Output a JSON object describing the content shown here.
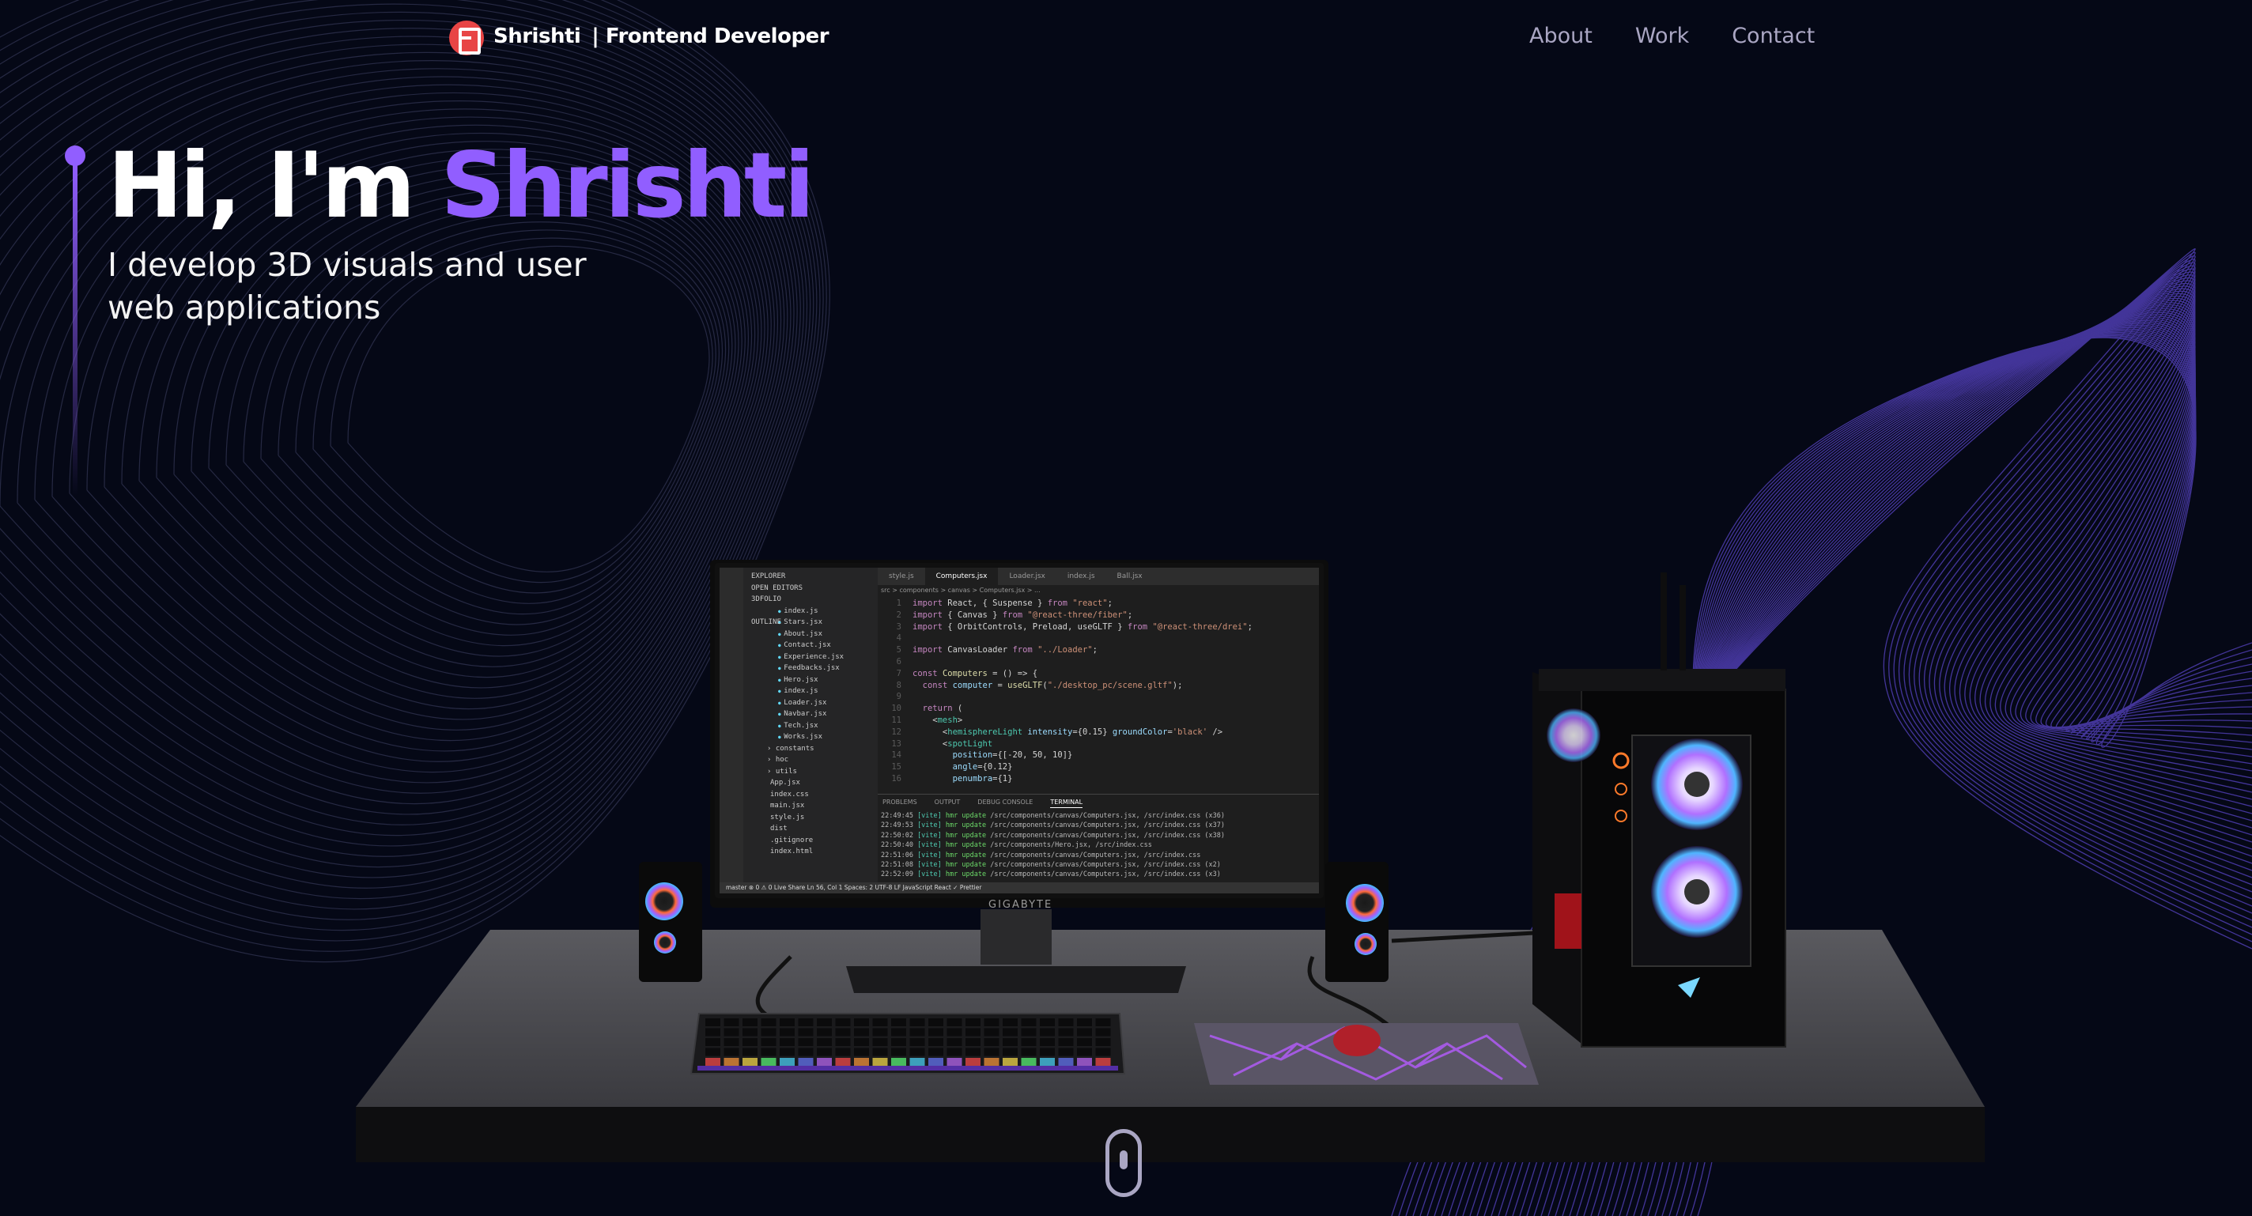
{
  "navbar": {
    "brand_name": "Shrishti",
    "brand_role": "| Frontend Developer",
    "links": [
      {
        "label": "About"
      },
      {
        "label": "Work"
      },
      {
        "label": "Contact"
      }
    ]
  },
  "hero": {
    "greeting": "Hi, I'm ",
    "name": "Shrishti",
    "subtitle_line1": "I develop 3D visuals and user",
    "subtitle_line2": "web applications"
  },
  "scene": {
    "monitor_brand": "GIGABYTE",
    "editor": {
      "sidebar_title": "EXPLORER",
      "open_editors": "OPEN EDITORS",
      "project": "3DFOLIO",
      "files": [
        "index.js",
        "Stars.jsx",
        "About.jsx",
        "Contact.jsx",
        "Experience.jsx",
        "Feedbacks.jsx",
        "Hero.jsx",
        "index.js",
        "Loader.jsx",
        "Navbar.jsx",
        "Tech.jsx",
        "Works.jsx"
      ],
      "folders": [
        "constants",
        "hoc",
        "utils"
      ],
      "root_files": [
        "App.jsx",
        "index.css",
        "main.jsx",
        "style.js",
        "dist",
        ".gitignore",
        "index.html"
      ],
      "outline": "OUTLINE",
      "tabs": [
        "style.js",
        "Computers.jsx",
        "Loader.jsx",
        "index.js",
        "Ball.jsx"
      ],
      "breadcrumb": "src > components > canvas > Computers.jsx > ...",
      "panel_tabs": [
        "PROBLEMS",
        "OUTPUT",
        "DEBUG CONSOLE",
        "TERMINAL"
      ],
      "status": "master   ⊗ 0 ⚠ 0    Live Share                                        Ln 56, Col 1   Spaces: 2   UTF-8   LF   JavaScript React   ✓ Prettier"
    }
  },
  "colors": {
    "background": "#050816",
    "accent": "#915eff",
    "secondary_text": "#aaa6c3",
    "logo": "#e84545"
  }
}
